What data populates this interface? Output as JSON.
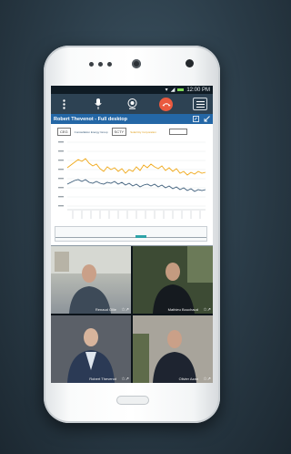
{
  "status_bar": {
    "time": "12:00 PM"
  },
  "toolbar": {
    "icons": [
      "menu-dots-icon",
      "mic-icon",
      "webcam-icon",
      "hangup-icon",
      "hamburger-icon"
    ]
  },
  "share": {
    "title": "Robert Thevenot - Full desktop",
    "legend": {
      "symbol1": "CEG",
      "name1": "Constellation Energy Group",
      "symbol2": "SCTY",
      "name2": "SolarCity Corporation"
    }
  },
  "participants": [
    {
      "name": "Renaud Ollie"
    },
    {
      "name": "Mathieu Bouchaud"
    },
    {
      "name": "Robert Thevenot"
    },
    {
      "name": "Olivier Azan"
    }
  ],
  "colors": {
    "accent": "#2467a6",
    "hangup": "#ea5a3f",
    "series1": "#f0a818",
    "series2": "#3a5b78"
  }
}
